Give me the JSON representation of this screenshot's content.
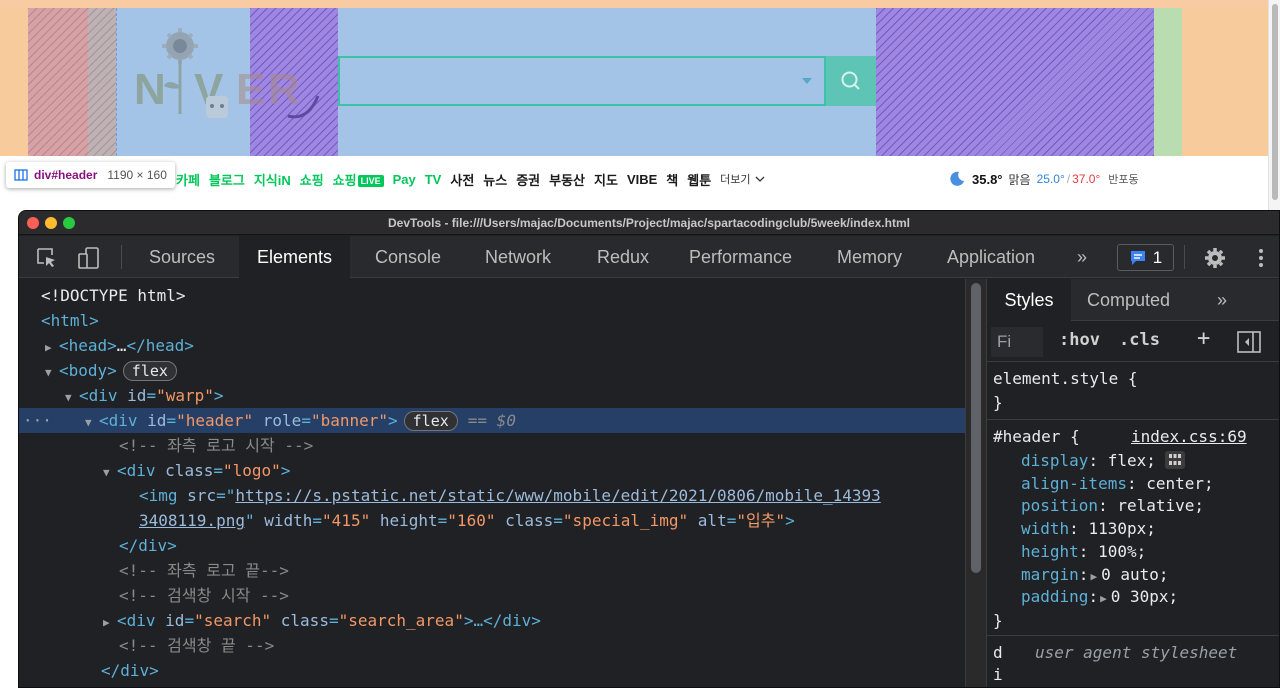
{
  "page": {
    "nav_items": [
      {
        "label": "카페",
        "color": "green"
      },
      {
        "label": "블로그",
        "color": "green"
      },
      {
        "label": "지식iN",
        "color": "green"
      },
      {
        "label": "쇼핑",
        "color": "green"
      },
      {
        "label": "쇼핑",
        "color": "green",
        "badge": "LIVE"
      },
      {
        "label": "Pay",
        "color": "green"
      },
      {
        "label": "TV",
        "color": "green"
      },
      {
        "label": "사전",
        "color": "dark"
      },
      {
        "label": "뉴스",
        "color": "dark"
      },
      {
        "label": "증권",
        "color": "dark"
      },
      {
        "label": "부동산",
        "color": "dark"
      },
      {
        "label": "지도",
        "color": "dark"
      },
      {
        "label": "VIBE",
        "color": "dark"
      },
      {
        "label": "책",
        "color": "dark"
      },
      {
        "label": "웹툰",
        "color": "dark"
      }
    ],
    "more_label": "더보기",
    "weather": {
      "temp": "35.8°",
      "condition": "맑음",
      "low": "25.0°",
      "sep": "/",
      "high": "37.0°",
      "area": "반포동"
    },
    "tooltip": {
      "element": "div#header",
      "size": "1190 × 160"
    }
  },
  "devtools": {
    "title": "DevTools - file:///Users/majac/Documents/Project/majac/spartacodingclub/5week/index.html",
    "tabs": [
      "Sources",
      "Elements",
      "Console",
      "Network",
      "Redux",
      "Performance",
      "Memory",
      "Application"
    ],
    "active_tab": "Elements",
    "more_tabs": "»",
    "issues_count": "1",
    "dom": {
      "doctype": "<!DOCTYPE html>",
      "html_tag": "<html>",
      "head_open": "<head>",
      "head_ellipsis": "…",
      "head_close": "</head>",
      "body_open": "<body>",
      "flex_badge": "flex",
      "warp_open": "<div ",
      "warp_attr": "id",
      "warp_val": "\"warp\"",
      "header_attr1": "id",
      "header_val1": "\"header\"",
      "header_attr2": "role",
      "header_val2": "\"banner\"",
      "eq_ref": "== $0",
      "comment1": "<!-- 좌측 로고 시작 -->",
      "logo_attr": "class",
      "logo_val": "\"logo\"",
      "img_attr_src": "src",
      "img_src_1": "https://s.pstatic.net/static/www/mobile/edit/2021/0806/mobile_14393",
      "img_src_2": "3408119.png",
      "img_attr_w": "width",
      "img_val_w": "\"415\"",
      "img_attr_h": "height",
      "img_val_h": "\"160\"",
      "img_attr_c": "class",
      "img_val_c": "\"special_img\"",
      "img_attr_alt": "alt",
      "img_val_alt": "\"입추\"",
      "div_close": "</div>",
      "comment2": "<!-- 좌측 로고 끝-->",
      "comment3": "<!-- 검색창 시작 -->",
      "search_attr_id": "id",
      "search_val_id": "\"search\"",
      "search_attr_c": "class",
      "search_val_c": "\"search_area\"",
      "search_tail": ">…</div>",
      "comment4": "<!-- 검색창 끝 -->"
    },
    "styles": {
      "tabs": [
        "Styles",
        "Computed"
      ],
      "more": "»",
      "filter_placeholder": "Fi",
      "hov": ":hov",
      "cls": ".cls",
      "plus": "+",
      "element_style": "element.style {",
      "close_brace": "}",
      "rule_selector": "#header {",
      "rule_source": "index.css:69",
      "declarations": [
        {
          "prop": "display",
          "value": "flex;"
        },
        {
          "prop": "align-items",
          "value": "center;"
        },
        {
          "prop": "position",
          "value": "relative;"
        },
        {
          "prop": "width",
          "value": "1130px;"
        },
        {
          "prop": "height",
          "value": "100%;"
        },
        {
          "prop": "margin",
          "value": "0 auto;"
        },
        {
          "prop": "padding",
          "value": "0 30px;"
        }
      ],
      "ua_selector": "d",
      "ua_label": "user agent stylesheet",
      "ua_line2": "i"
    }
  }
}
